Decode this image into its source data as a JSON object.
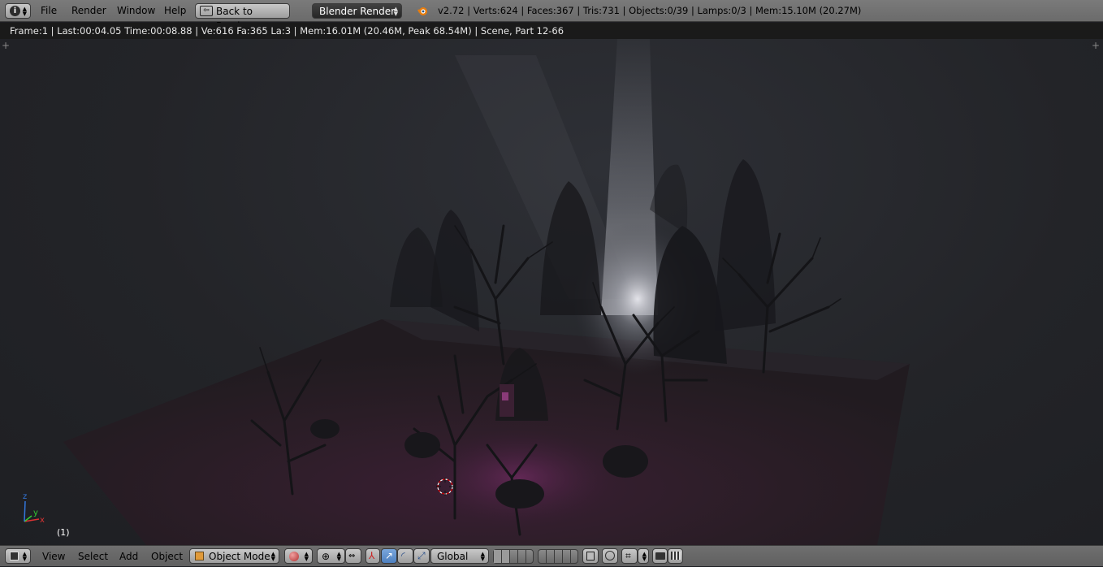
{
  "header": {
    "menus": [
      "File",
      "Render",
      "Window",
      "Help"
    ],
    "back_label": "Back to Previous",
    "render_engine": "Blender Render",
    "stats": "v2.72 | Verts:624 | Faces:367 | Tris:731 | Objects:0/39 | Lamps:0/3 | Mem:15.10M (20.27M)"
  },
  "render_info": "Frame:1 | Last:00:04.05 Time:00:08.88 | Ve:616 Fa:365 La:3 | Mem:16.01M (20.46M, Peak 68.54M) | Scene, Part 12-66",
  "viewport": {
    "frame_label": "(1)",
    "axis_labels": {
      "x": "x",
      "y": "y",
      "z": "z"
    }
  },
  "footer": {
    "menus": [
      "View",
      "Select",
      "Add",
      "Object"
    ],
    "mode": "Object Mode",
    "orientation": "Global"
  },
  "colors": {
    "header_bg": "#717171",
    "infobar_bg": "#1a1a1a",
    "active_blue": "#5680c2",
    "viewport_bg": "#232428"
  }
}
